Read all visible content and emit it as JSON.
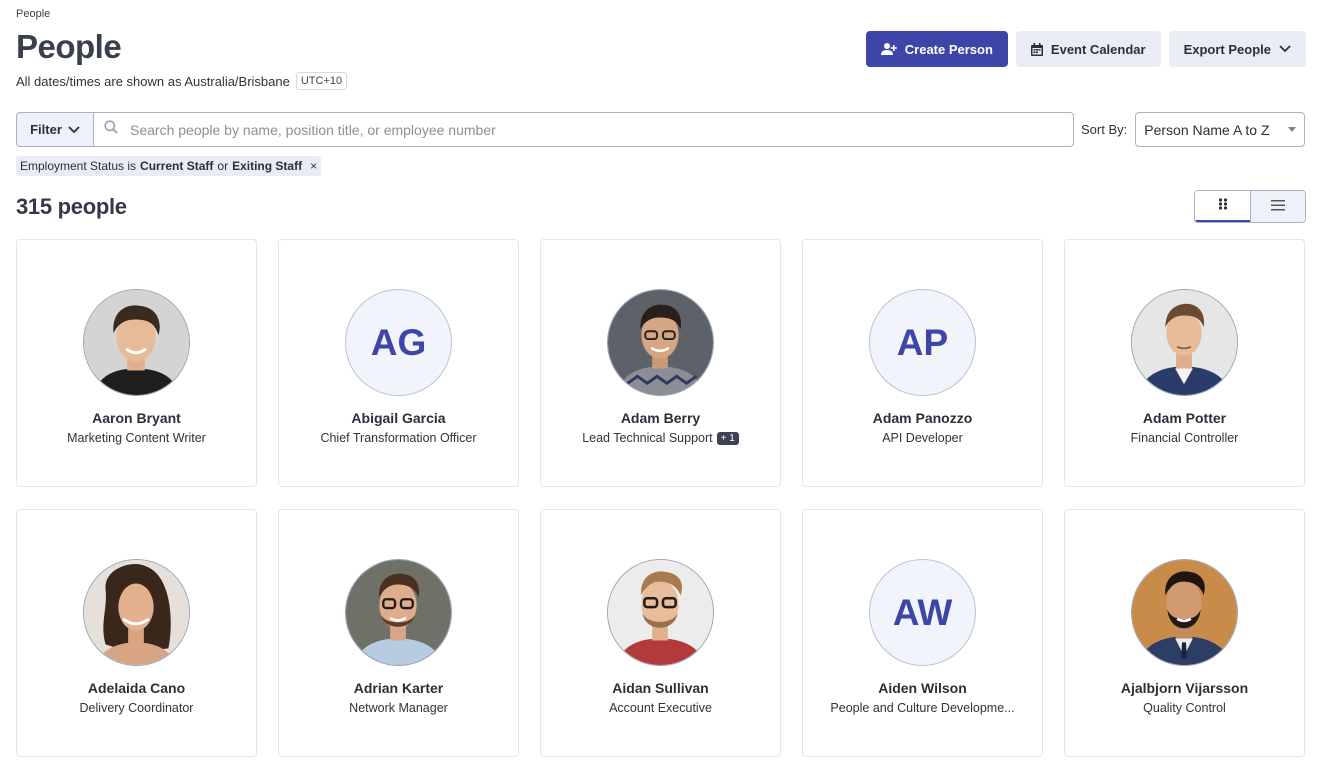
{
  "breadcrumb": "People",
  "title": "People",
  "timezone": {
    "text": "All dates/times are shown as Australia/Brisbane",
    "offset": "UTC+10"
  },
  "actions": {
    "create": "Create Person",
    "calendar": "Event Calendar",
    "export": "Export People"
  },
  "filter": {
    "label": "Filter",
    "search_placeholder": "Search people by name, position title, or employee number",
    "search_value": "",
    "sort_label": "Sort By:",
    "sort_value": "Person Name A to Z"
  },
  "chip": {
    "prefix": "Employment Status is",
    "value1": "Current Staff",
    "joiner": "or",
    "value2": "Exiting Staff",
    "close": "×"
  },
  "count": "315 people",
  "colors": {
    "primary": "#3d46a8",
    "secondary_bg": "#e9ecf3",
    "initials_bg": "#f1f4fb"
  },
  "people": [
    {
      "name": "Aaron Bryant",
      "position": "Marketing Content Writer",
      "avatar": "photo"
    },
    {
      "name": "Abigail Garcia",
      "position": "Chief Transformation Officer",
      "avatar": "initials",
      "initials": "AG"
    },
    {
      "name": "Adam Berry",
      "position": "Lead Technical Support",
      "avatar": "photo",
      "extra": "+ 1"
    },
    {
      "name": "Adam Panozzo",
      "position": "API Developer",
      "avatar": "initials",
      "initials": "AP"
    },
    {
      "name": "Adam Potter",
      "position": "Financial Controller",
      "avatar": "photo"
    },
    {
      "name": "Adelaida Cano",
      "position": "Delivery Coordinator",
      "avatar": "photo"
    },
    {
      "name": "Adrian Karter",
      "position": "Network Manager",
      "avatar": "photo"
    },
    {
      "name": "Aidan Sullivan",
      "position": "Account Executive",
      "avatar": "photo"
    },
    {
      "name": "Aiden Wilson",
      "position": "People and Culture Developme...",
      "avatar": "initials",
      "initials": "AW"
    },
    {
      "name": "Ajalbjorn Vijarsson",
      "position": "Quality Control",
      "avatar": "photo"
    }
  ]
}
